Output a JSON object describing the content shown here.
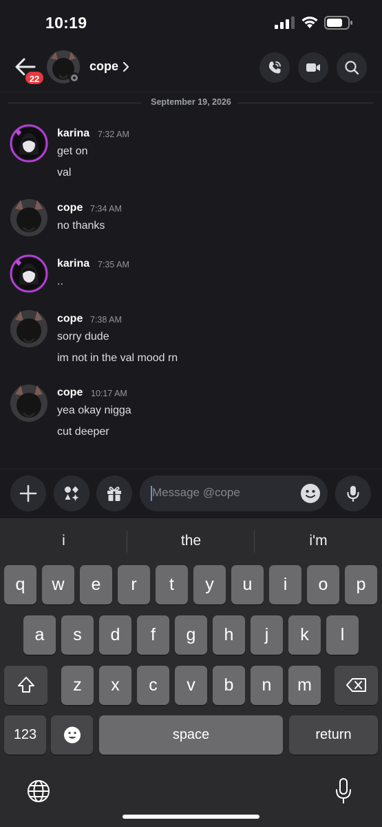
{
  "status_bar": {
    "time": "10:19",
    "icons": [
      "cellular-signal-icon",
      "wifi-icon",
      "battery-icon"
    ]
  },
  "header": {
    "back_icon": "arrow-left-icon",
    "unread_count": "22",
    "contact_name": "cope",
    "actions": [
      "voice-call-icon",
      "video-call-icon",
      "search-icon"
    ]
  },
  "conversation": {
    "date_separator": "September 19, 2026",
    "messages": [
      {
        "author": "karina",
        "time": "7:32 AM",
        "lines": [
          "get on",
          "val"
        ]
      },
      {
        "author": "cope",
        "time": "7:34 AM",
        "lines": [
          "no thanks"
        ]
      },
      {
        "author": "karina",
        "time": "7:35 AM",
        "lines": [
          ".."
        ]
      },
      {
        "author": "cope",
        "time": "7:38 AM",
        "lines": [
          "sorry dude",
          "im not in the val mood rn"
        ]
      },
      {
        "author": "cope",
        "time": "10:17 AM",
        "lines": [
          "yea okay nigga",
          "cut deeper"
        ]
      }
    ]
  },
  "composer": {
    "placeholder": "Message @cope",
    "buttons": [
      "plus-icon",
      "apps-icon",
      "gift-icon",
      "emoji-icon",
      "microphone-icon"
    ]
  },
  "keyboard": {
    "suggestions": [
      "i",
      "the",
      "i'm"
    ],
    "row1": [
      "q",
      "w",
      "e",
      "r",
      "t",
      "y",
      "u",
      "i",
      "o",
      "p"
    ],
    "row2": [
      "a",
      "s",
      "d",
      "f",
      "g",
      "h",
      "j",
      "k",
      "l"
    ],
    "row3": [
      "z",
      "x",
      "c",
      "v",
      "b",
      "n",
      "m"
    ],
    "numbers_label": "123",
    "space_label": "space",
    "return_label": "return"
  },
  "colors": {
    "background": "#1a1a1e",
    "surface": "#2a2b30",
    "badge": "#e5393f",
    "keyboard": "#2b2b2d"
  }
}
